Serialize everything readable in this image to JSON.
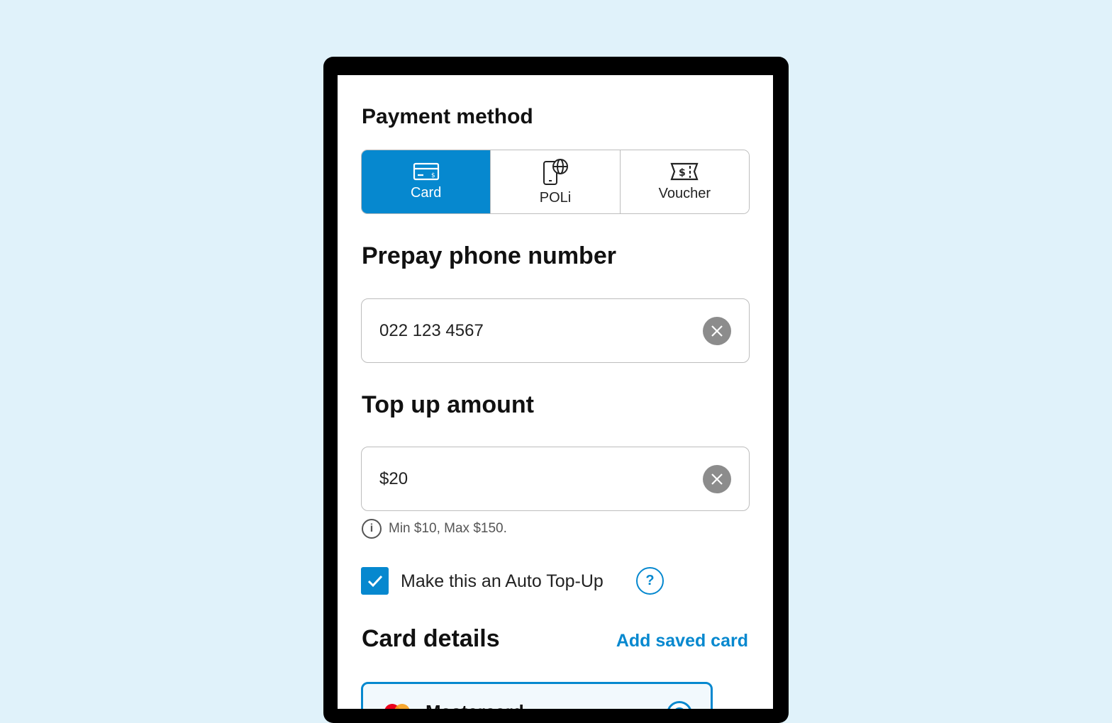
{
  "payment_method": {
    "title": "Payment method",
    "options": [
      {
        "label": "Card",
        "icon": "credit-card-icon",
        "selected": true
      },
      {
        "label": "POLi",
        "icon": "phone-globe-icon",
        "selected": false
      },
      {
        "label": "Voucher",
        "icon": "voucher-ticket-icon",
        "selected": false
      }
    ]
  },
  "prepay": {
    "title": "Prepay phone number",
    "value": "022 123 4567"
  },
  "topup": {
    "title": "Top up amount",
    "value": "$20",
    "hint": "Min $10, Max $150."
  },
  "auto_topup": {
    "label": "Make this an Auto Top-Up",
    "checked": true
  },
  "card_details": {
    "title": "Card details",
    "add_saved_label": "Add saved card",
    "saved_card": {
      "label": "Mastercard",
      "selected": true
    }
  },
  "colors": {
    "accent": "#0688cf",
    "background": "#e0f2fa",
    "clear_button": "#8c8c8c"
  }
}
